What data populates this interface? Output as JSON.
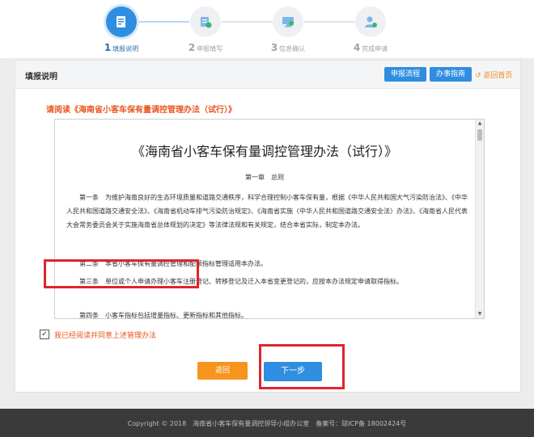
{
  "steps": [
    {
      "num": "1",
      "label": "填报说明"
    },
    {
      "num": "2",
      "label": "申报填写"
    },
    {
      "num": "3",
      "label": "信息确认"
    },
    {
      "num": "4",
      "label": "完成申请"
    }
  ],
  "panel": {
    "title": "填报说明",
    "process_btn": "申报流程",
    "guide_btn": "办事指南",
    "back_home": "返回首页"
  },
  "read_title": "请阅读《海南省小客车保有量调控管理办法（试行）》",
  "document": {
    "title": "《海南省小客车保有量调控管理办法（试行）》",
    "chapter": "第一章　总则",
    "paragraphs": [
      "第一条　为维护海南良好的生态环境质量和道路交通秩序，科学合理控制小客车保有量，根据《中华人民共和国大气污染防治法》、《中华人民共和国道路交通安全法》、《海南省机动车排气污染防治规定》、《海南省实施〈中华人民共和国道路交通安全法〉办法》、《海南省人民代表大会常务委员会关于实施海南省总体规划的决定》等法律法规和有关规定，结合本省实际，制定本办法。",
      "第二条　本省小客车保有量调控管理和配额指标管理适用本办法。",
      "第三条　单位或个人申请办理小客车注册登记、转移登记及迁入本省变更登记的，应按本办法规定申请取得指标。",
      "第四条　小客车指标包括增量指标、更新指标和其他指标。"
    ]
  },
  "agree_text": "我已经阅读并同意上述管理办法",
  "agree_checked": "✓",
  "buttons": {
    "back": "返回",
    "next": "下一步"
  },
  "footer": "Copyright © 2018　海南省小客车保有量调控领导小组办公室　备案号：琼ICP备 18002424号",
  "colors": {
    "primary": "#2f8ee0",
    "orange": "#f7941d",
    "highlight_red": "#e0242b",
    "title_red": "#e9551e",
    "footer_bg": "#3a3a3a"
  }
}
